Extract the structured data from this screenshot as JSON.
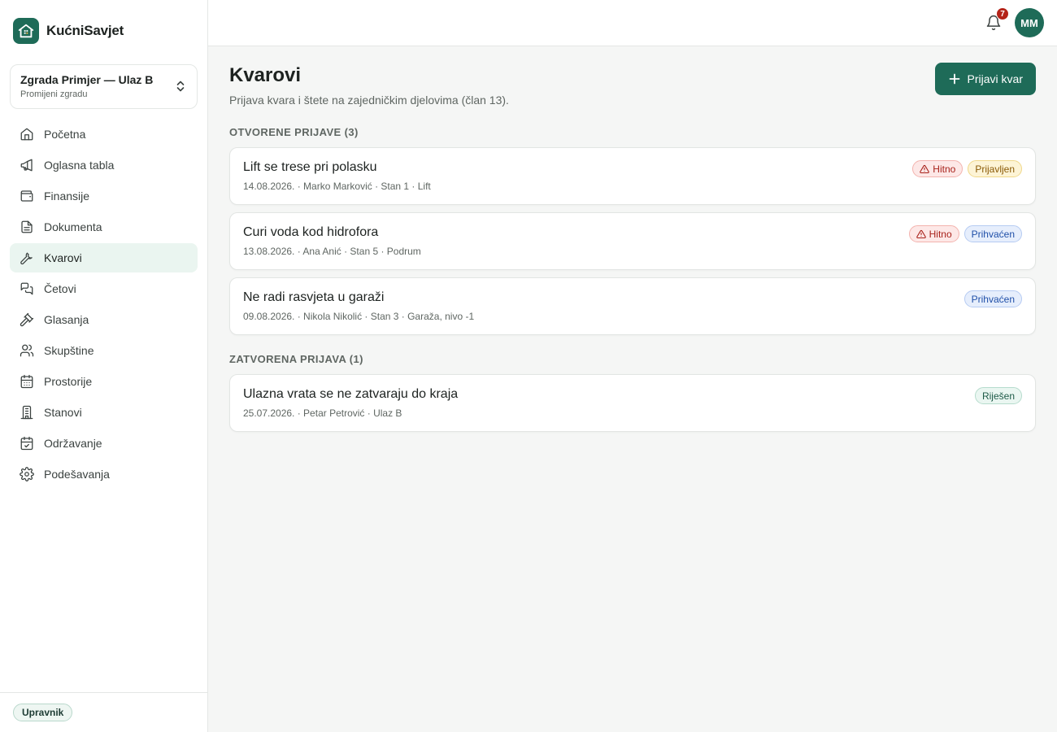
{
  "app": {
    "name": "KućniSavjet"
  },
  "building": {
    "name": "Zgrada Primjer — Ulaz B",
    "change_label": "Promijeni zgradu"
  },
  "nav": [
    {
      "key": "home",
      "label": "Početna",
      "icon": "home-icon"
    },
    {
      "key": "board",
      "label": "Oglasna tabla",
      "icon": "megaphone-icon"
    },
    {
      "key": "finance",
      "label": "Finansije",
      "icon": "wallet-icon"
    },
    {
      "key": "docs",
      "label": "Dokumenta",
      "icon": "document-icon"
    },
    {
      "key": "faults",
      "label": "Kvarovi",
      "icon": "wrench-icon",
      "active": true
    },
    {
      "key": "chats",
      "label": "Četovi",
      "icon": "chat-icon"
    },
    {
      "key": "votes",
      "label": "Glasanja",
      "icon": "gavel-icon"
    },
    {
      "key": "meetings",
      "label": "Skupštine",
      "icon": "users-icon"
    },
    {
      "key": "rooms",
      "label": "Prostorije",
      "icon": "calendar-icon"
    },
    {
      "key": "apartments",
      "label": "Stanovi",
      "icon": "building-icon"
    },
    {
      "key": "maintenance",
      "label": "Održavanje",
      "icon": "calendar-check-icon"
    },
    {
      "key": "settings",
      "label": "Podešavanja",
      "icon": "gear-icon"
    }
  ],
  "role": "Upravnik",
  "topbar": {
    "notifications_count": "7",
    "avatar_initials": "MM"
  },
  "page": {
    "title": "Kvarovi",
    "subtitle": "Prijava kvara i štete na zajedničkim djelovima (član 13).",
    "report_button": "Prijavi kvar"
  },
  "open_section": {
    "heading": "Otvorene prijave (3)",
    "items": [
      {
        "title": "Lift se trese pri polasku",
        "meta": "14.08.2026. · Marko Marković · Stan 1 · Lift",
        "urgent": "Hitno",
        "status": "Prijavljen",
        "status_type": "reported"
      },
      {
        "title": "Curi voda kod hidrofora",
        "meta": "13.08.2026. · Ana Anić · Stan 5 · Podrum",
        "urgent": "Hitno",
        "status": "Prihvaćen",
        "status_type": "accepted"
      },
      {
        "title": "Ne radi rasvjeta u garaži",
        "meta": "09.08.2026. · Nikola Nikolić · Stan 3 · Garaža, nivo -1",
        "urgent": "",
        "status": "Prihvaćen",
        "status_type": "accepted"
      }
    ]
  },
  "closed_section": {
    "heading": "Zatvorena prijava (1)",
    "items": [
      {
        "title": "Ulazna vrata se ne zatvaraju do kraja",
        "meta": "25.07.2026. · Petar Petrović · Ulaz B",
        "urgent": "",
        "status": "Riješen",
        "status_type": "resolved"
      }
    ]
  },
  "colors": {
    "brand": "#1e6b58",
    "active_nav_bg": "#eaf5f0",
    "urgent": "#a8221b",
    "reported": "#8a5a06",
    "accepted": "#1f4fa8",
    "resolved": "#1d5a47"
  }
}
